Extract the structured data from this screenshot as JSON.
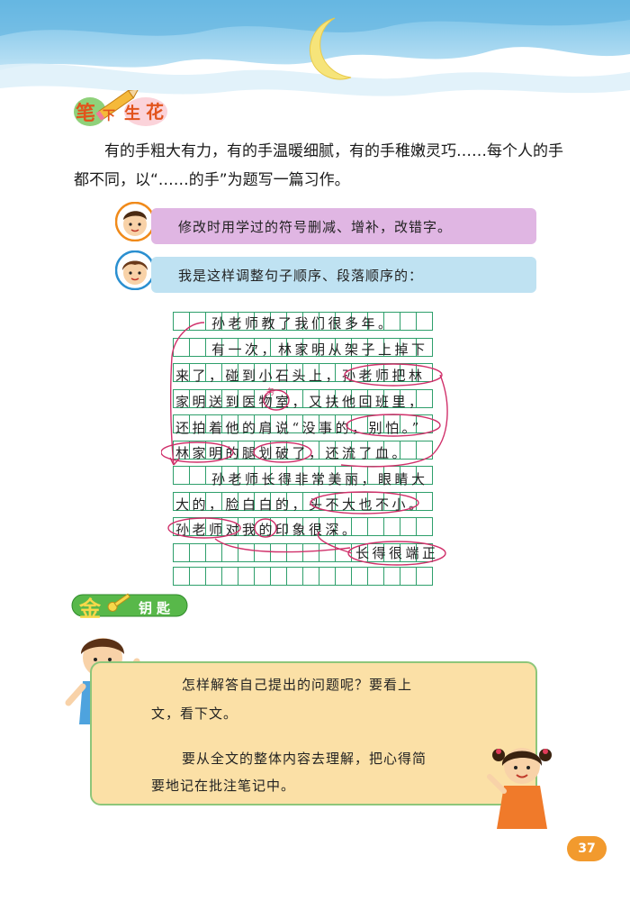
{
  "section_title": "笔下生花",
  "badge_chars": [
    "笔",
    "下",
    "生",
    "花"
  ],
  "prompt_text": "有的手粗大有力，有的手温暖细腻，有的手稚嫩灵巧……每个人的手都不同，以“……的手”为题写一篇习作。",
  "tips": [
    "修改时用学过的符号删减、增补，改错字。",
    "我是这样调整句子顺序、段落顺序的："
  ],
  "draft_lines": [
    "孙老师教了我们很多年。",
    "有一次，林家明从架子上掉下",
    "来了，碰到小石头上，孙老师把林",
    "家明送到医物室，又扶他回班里，",
    "还拍着他的肩说“没事的，别怕。”",
    "林家明的腿划破了，还流了血。",
    "孙老师长得非常美丽，眼睛大",
    "大的，脸白白的，头不大也不小。",
    "孙老师对我的印象很深。",
    "长得很端正"
  ],
  "draft_insert_mark": "务",
  "key_section_title": "金钥匙",
  "key_badge_chars": [
    "金",
    "钥",
    "匙"
  ],
  "key_paragraphs": [
    "怎样解答自己提出的问题呢？要看上文，看下文。",
    "要从全文的整体内容去理解，把心得简要地记在批注笔记中。"
  ],
  "key_lines": [
    "怎样解答自己提出的问题呢？要看上",
    "文，看下文。",
    "要从全文的整体内容去理解，把心得简",
    "要地记在批注笔记中。"
  ],
  "page_number": "37",
  "colors": {
    "sky": "#7fc6ea",
    "moon": "#f6e47a",
    "tip1_bg": "#e0b6e3",
    "tip2_bg": "#bfe2f2",
    "grid_green": "#2e9f6b",
    "edit_mark": "#d0306a",
    "key_box_bg": "#fbe0a6",
    "key_box_border": "#8dc67a",
    "page_badge": "#f29a2e"
  },
  "icons": [
    "pencil-icon",
    "moon-icon",
    "key-icon",
    "boy-avatar-icon",
    "girl-avatar-icon"
  ]
}
